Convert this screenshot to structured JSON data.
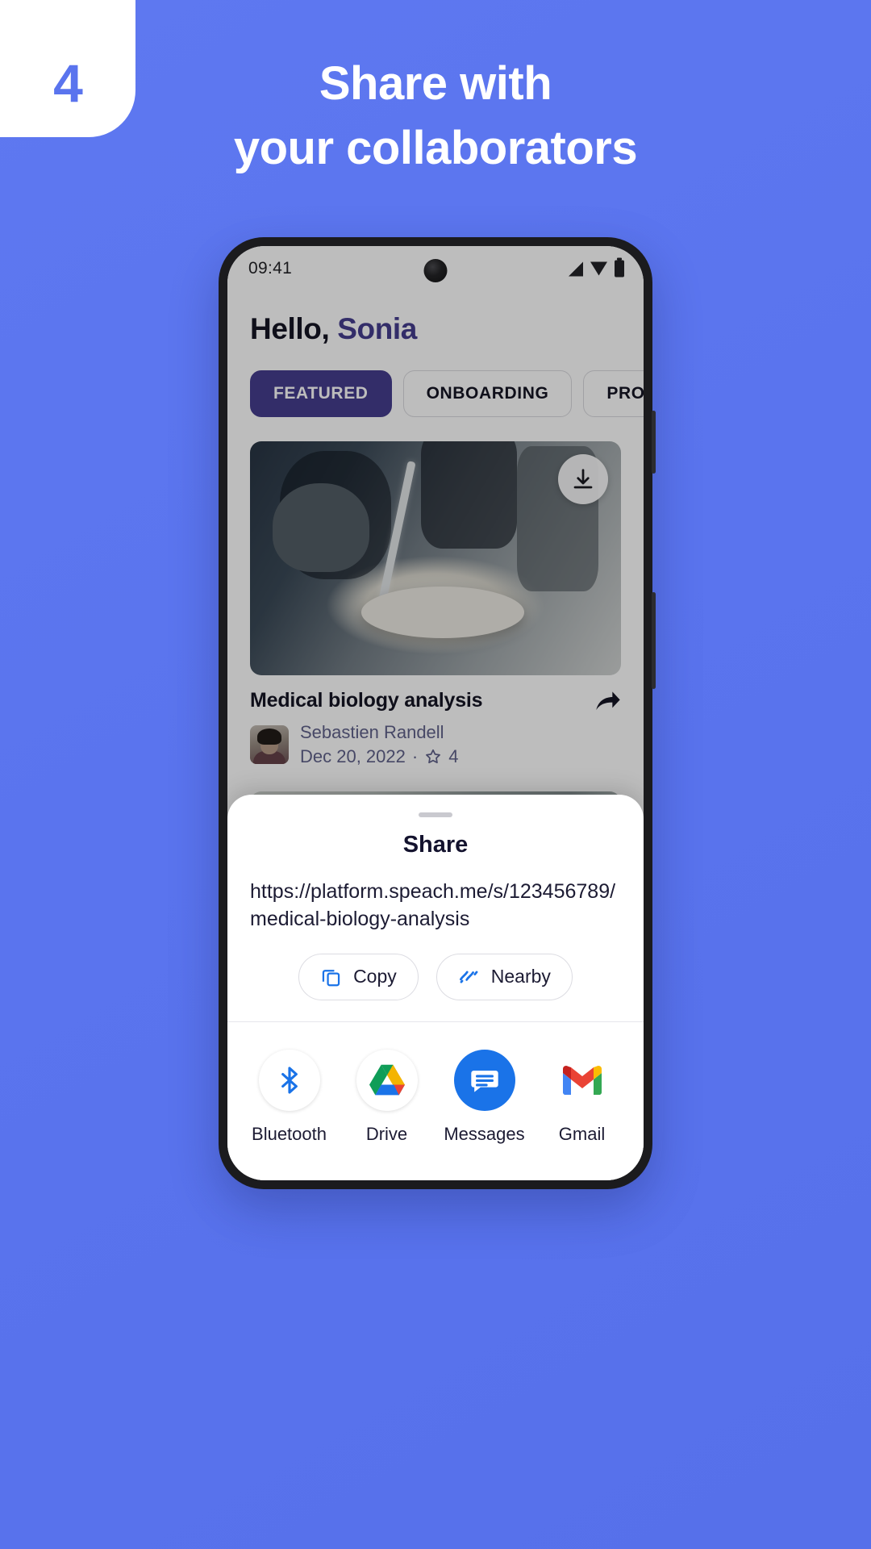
{
  "promo": {
    "step_number": "4",
    "headline_line1": "Share with",
    "headline_line2": "your collaborators",
    "bg_color": "#5a74ee",
    "accent_color": "#4637c9"
  },
  "phone": {
    "statusbar": {
      "time": "09:41",
      "icons": [
        "signal-icon",
        "wifi-icon",
        "battery-icon"
      ]
    },
    "greeting": {
      "prefix": "Hello, ",
      "name": "Sonia"
    },
    "tabs": [
      {
        "label": "FEATURED",
        "active": true
      },
      {
        "label": "ONBOARDING",
        "active": false
      },
      {
        "label": "PROCEDURES",
        "active": false
      }
    ],
    "cards": [
      {
        "title": "Medical biology analysis",
        "author": "Sebastien Randell",
        "date": "Dec 20, 2022",
        "separator": "·",
        "rating": "4",
        "download_icon": "download-icon",
        "share_icon": "share-arrow-icon",
        "star_icon": "star-icon",
        "thumb_alt": "laboratory pipette over petri dish"
      },
      {
        "title": "",
        "author": "",
        "date": "",
        "separator": "",
        "rating": "",
        "download_icon": "download-icon",
        "share_icon": "",
        "star_icon": "",
        "thumb_alt": "portrait of a woman"
      }
    ]
  },
  "share_sheet": {
    "title": "Share",
    "url": "https://platform.speach.me/s/123456789/medical-biology-analysis",
    "chips": [
      {
        "label": "Copy",
        "icon": "copy-icon"
      },
      {
        "label": "Nearby",
        "icon": "nearby-share-icon"
      }
    ],
    "apps": [
      {
        "label": "Bluetooth",
        "icon": "bluetooth-icon"
      },
      {
        "label": "Drive",
        "icon": "google-drive-icon"
      },
      {
        "label": "Messages",
        "icon": "google-messages-icon"
      },
      {
        "label": "Gmail",
        "icon": "gmail-icon"
      }
    ]
  }
}
